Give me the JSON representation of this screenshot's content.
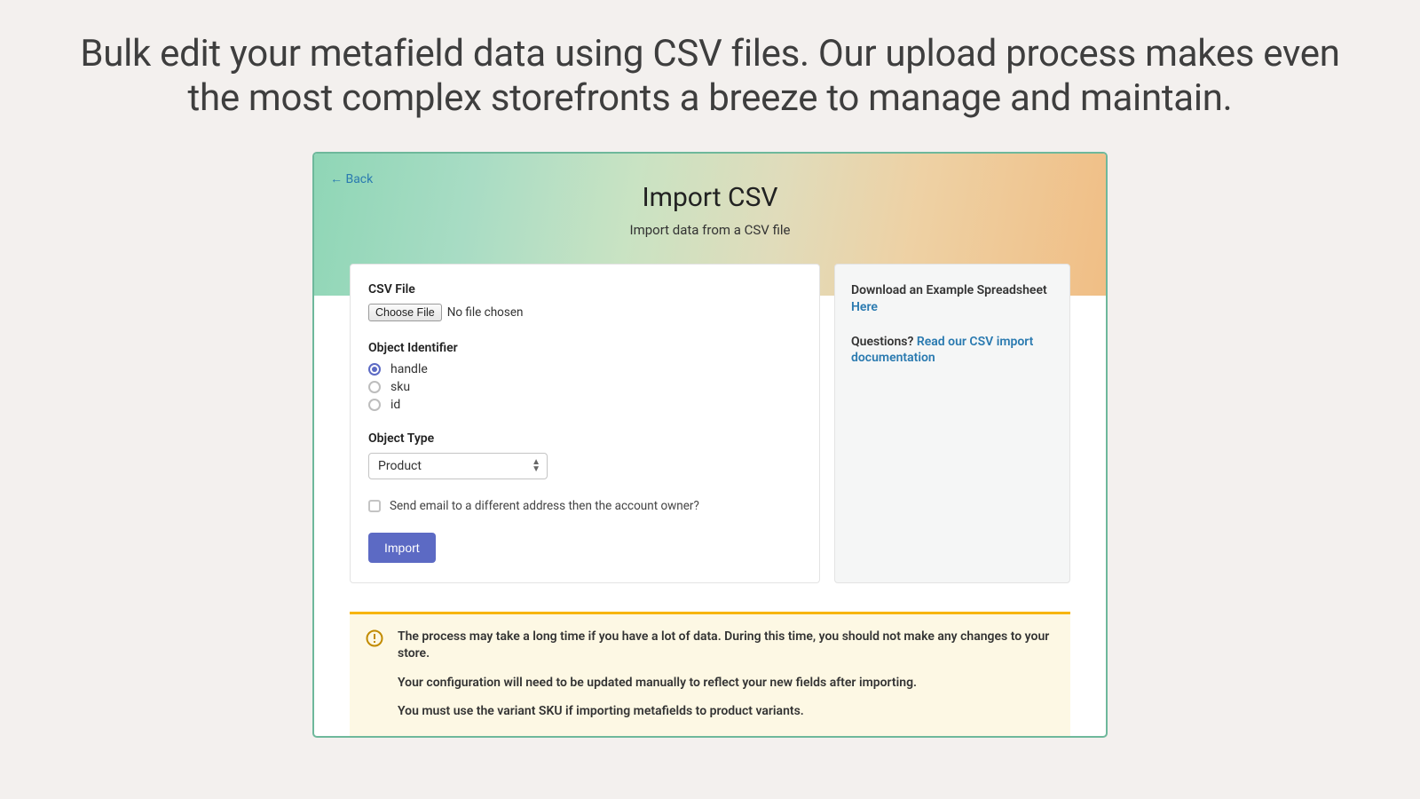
{
  "page": {
    "heading": "Bulk edit your metafield data using CSV files. Our upload process makes even the most complex storefronts a breeze to manage and maintain."
  },
  "header": {
    "back_label": "← Back",
    "title": "Import CSV",
    "subtitle": "Import data from a CSV file"
  },
  "form": {
    "csv_file_label": "CSV File",
    "choose_file_label": "Choose File",
    "file_status": "No file chosen",
    "object_identifier_label": "Object Identifier",
    "identifiers": [
      {
        "label": "handle",
        "selected": true
      },
      {
        "label": "sku",
        "selected": false
      },
      {
        "label": "id",
        "selected": false
      }
    ],
    "object_type_label": "Object Type",
    "object_type_value": "Product",
    "email_checkbox_label": "Send email to a different address then the account owner?",
    "import_button": "Import"
  },
  "sidebar": {
    "example_text": "Download an Example Spreadsheet ",
    "example_link": "Here",
    "questions_text": "Questions? ",
    "docs_link": "Read our CSV import documentation"
  },
  "warning": {
    "line1": "The process may take a long time if you have a lot of data. During this time, you should not make any changes to your store.",
    "line2": "Your configuration will need to be updated manually to reflect your new fields after importing.",
    "line3": "You must use the variant SKU if importing metafields to product variants."
  }
}
